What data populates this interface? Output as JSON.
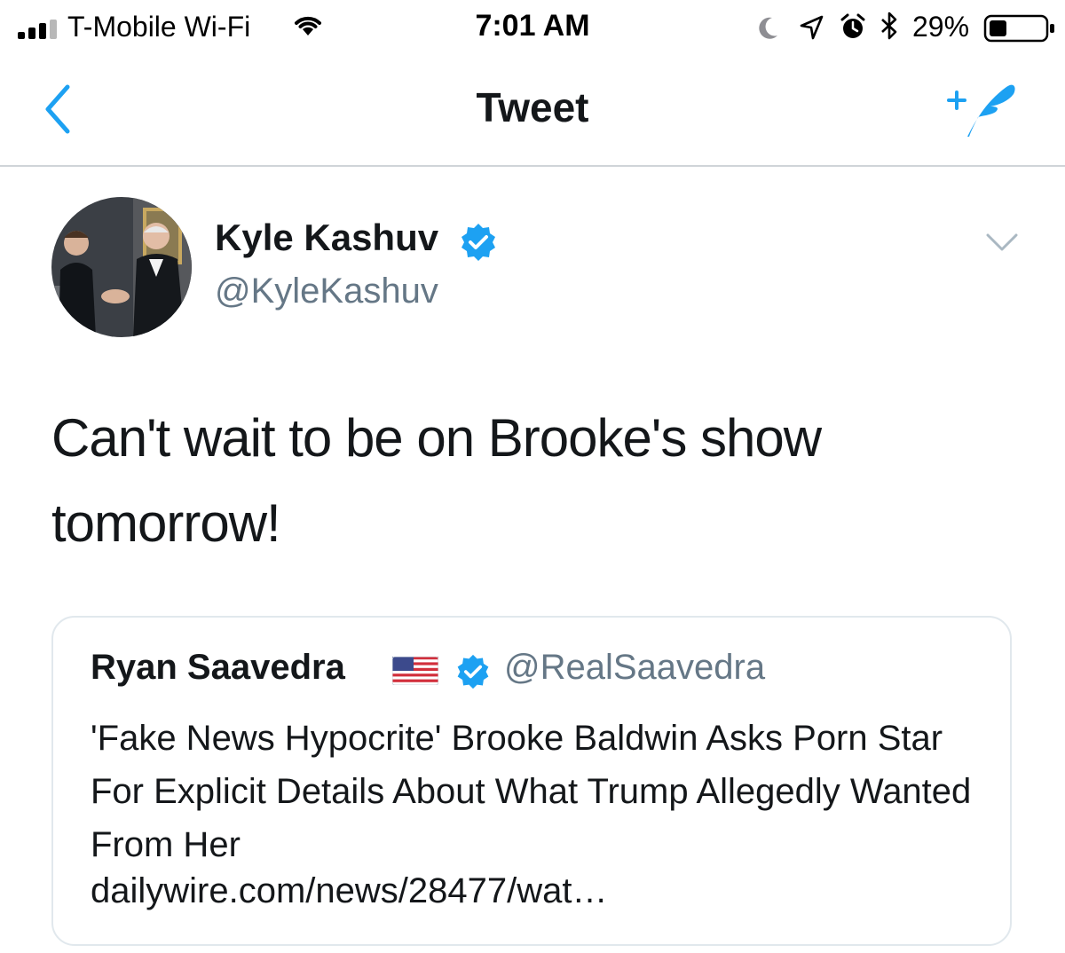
{
  "status_bar": {
    "carrier": "T-Mobile Wi-Fi",
    "time": "7:01 AM",
    "battery": "29%",
    "icons": [
      "signal-icon",
      "wifi-icon",
      "moon-icon",
      "location-icon",
      "alarm-icon",
      "bluetooth-icon",
      "battery-icon"
    ]
  },
  "nav": {
    "title": "Tweet",
    "back_icon": "chevron-left-icon",
    "compose_icon": "compose-tweet-icon"
  },
  "tweet": {
    "author_name": "Kyle Kashuv",
    "author_handle": "@KyleKashuv",
    "text": "Can't wait to be on Brooke's show tomorrow!",
    "avatar_icon": "avatar"
  },
  "quoted_tweet": {
    "author_name": "Ryan Saavedra",
    "author_handle": "@RealSaavedra",
    "text": "'Fake News Hypocrite' Brooke Baldwin Asks Porn Star For Explicit Details About What Trump Allegedly Wanted From Her",
    "link": "dailywire.com/news/28477/wat…"
  },
  "colors": {
    "accent": "#1da1f2",
    "handle_gray": "#657786",
    "text_dark": "#14171a",
    "border": "#e1e8ed"
  }
}
